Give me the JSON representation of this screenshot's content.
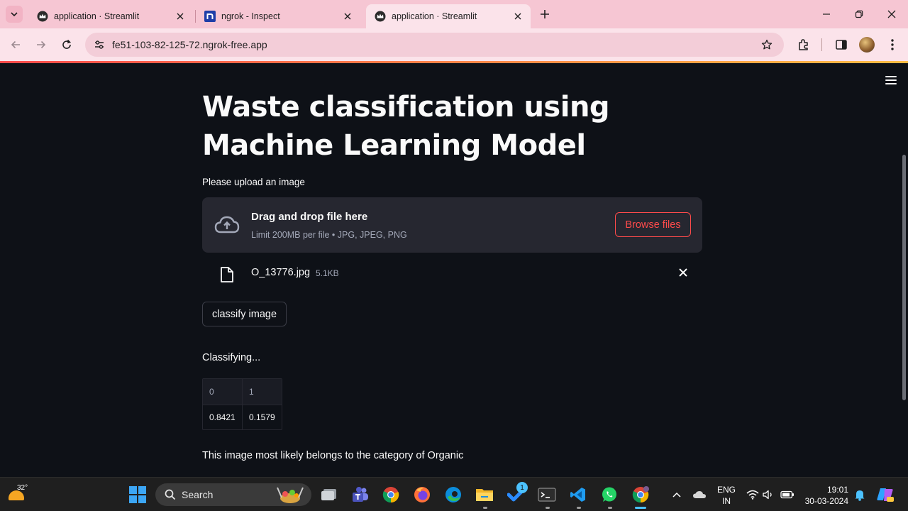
{
  "browser": {
    "tabs": [
      {
        "title": "application · Streamlit",
        "favicon": "streamlit-crown-icon",
        "active": false
      },
      {
        "title": "ngrok - Inspect",
        "favicon": "ngrok-n-icon",
        "active": false
      },
      {
        "title": "application · Streamlit",
        "favicon": "streamlit-crown-icon",
        "active": true
      }
    ],
    "url": "fe51-103-82-125-72.ngrok-free.app",
    "colors": {
      "tabbar": "#f6c6d3",
      "toolbar": "#fbe3ea",
      "omnibox": "#f3cdd8"
    }
  },
  "app": {
    "title": "Waste classification using Machine Learning Model",
    "uploader": {
      "label": "Please upload an image",
      "drop_text": "Drag and drop file here",
      "limit_text": "Limit 200MB per file • JPG, JPEG, PNG",
      "browse_label": "Browse files"
    },
    "file": {
      "name": "O_13776.jpg",
      "size": "5.1KB"
    },
    "classify_label": "classify image",
    "status": "Classifying...",
    "dataframe": {
      "columns": [
        "0",
        "1"
      ],
      "rows": [
        [
          "0.8421",
          "0.1579"
        ]
      ]
    },
    "result": "This image most likely belongs to the category of Organic",
    "colors": {
      "background": "#0e1117",
      "accent": "#ff4b4b",
      "panel": "#262730"
    }
  },
  "taskbar": {
    "weather_temp": "32°",
    "search_placeholder": "Search",
    "apps": [
      "file-manager-icon",
      "teams-icon",
      "chrome-icon",
      "firefox-icon",
      "edge-icon",
      "file-explorer-icon",
      "todo-icon",
      "terminal-icon",
      "vscode-icon",
      "whatsapp-icon",
      "chrome-canary-icon"
    ],
    "todo_badge": "1",
    "language": {
      "line1": "ENG",
      "line2": "IN"
    },
    "time": "19:01",
    "date": "30-03-2024"
  }
}
